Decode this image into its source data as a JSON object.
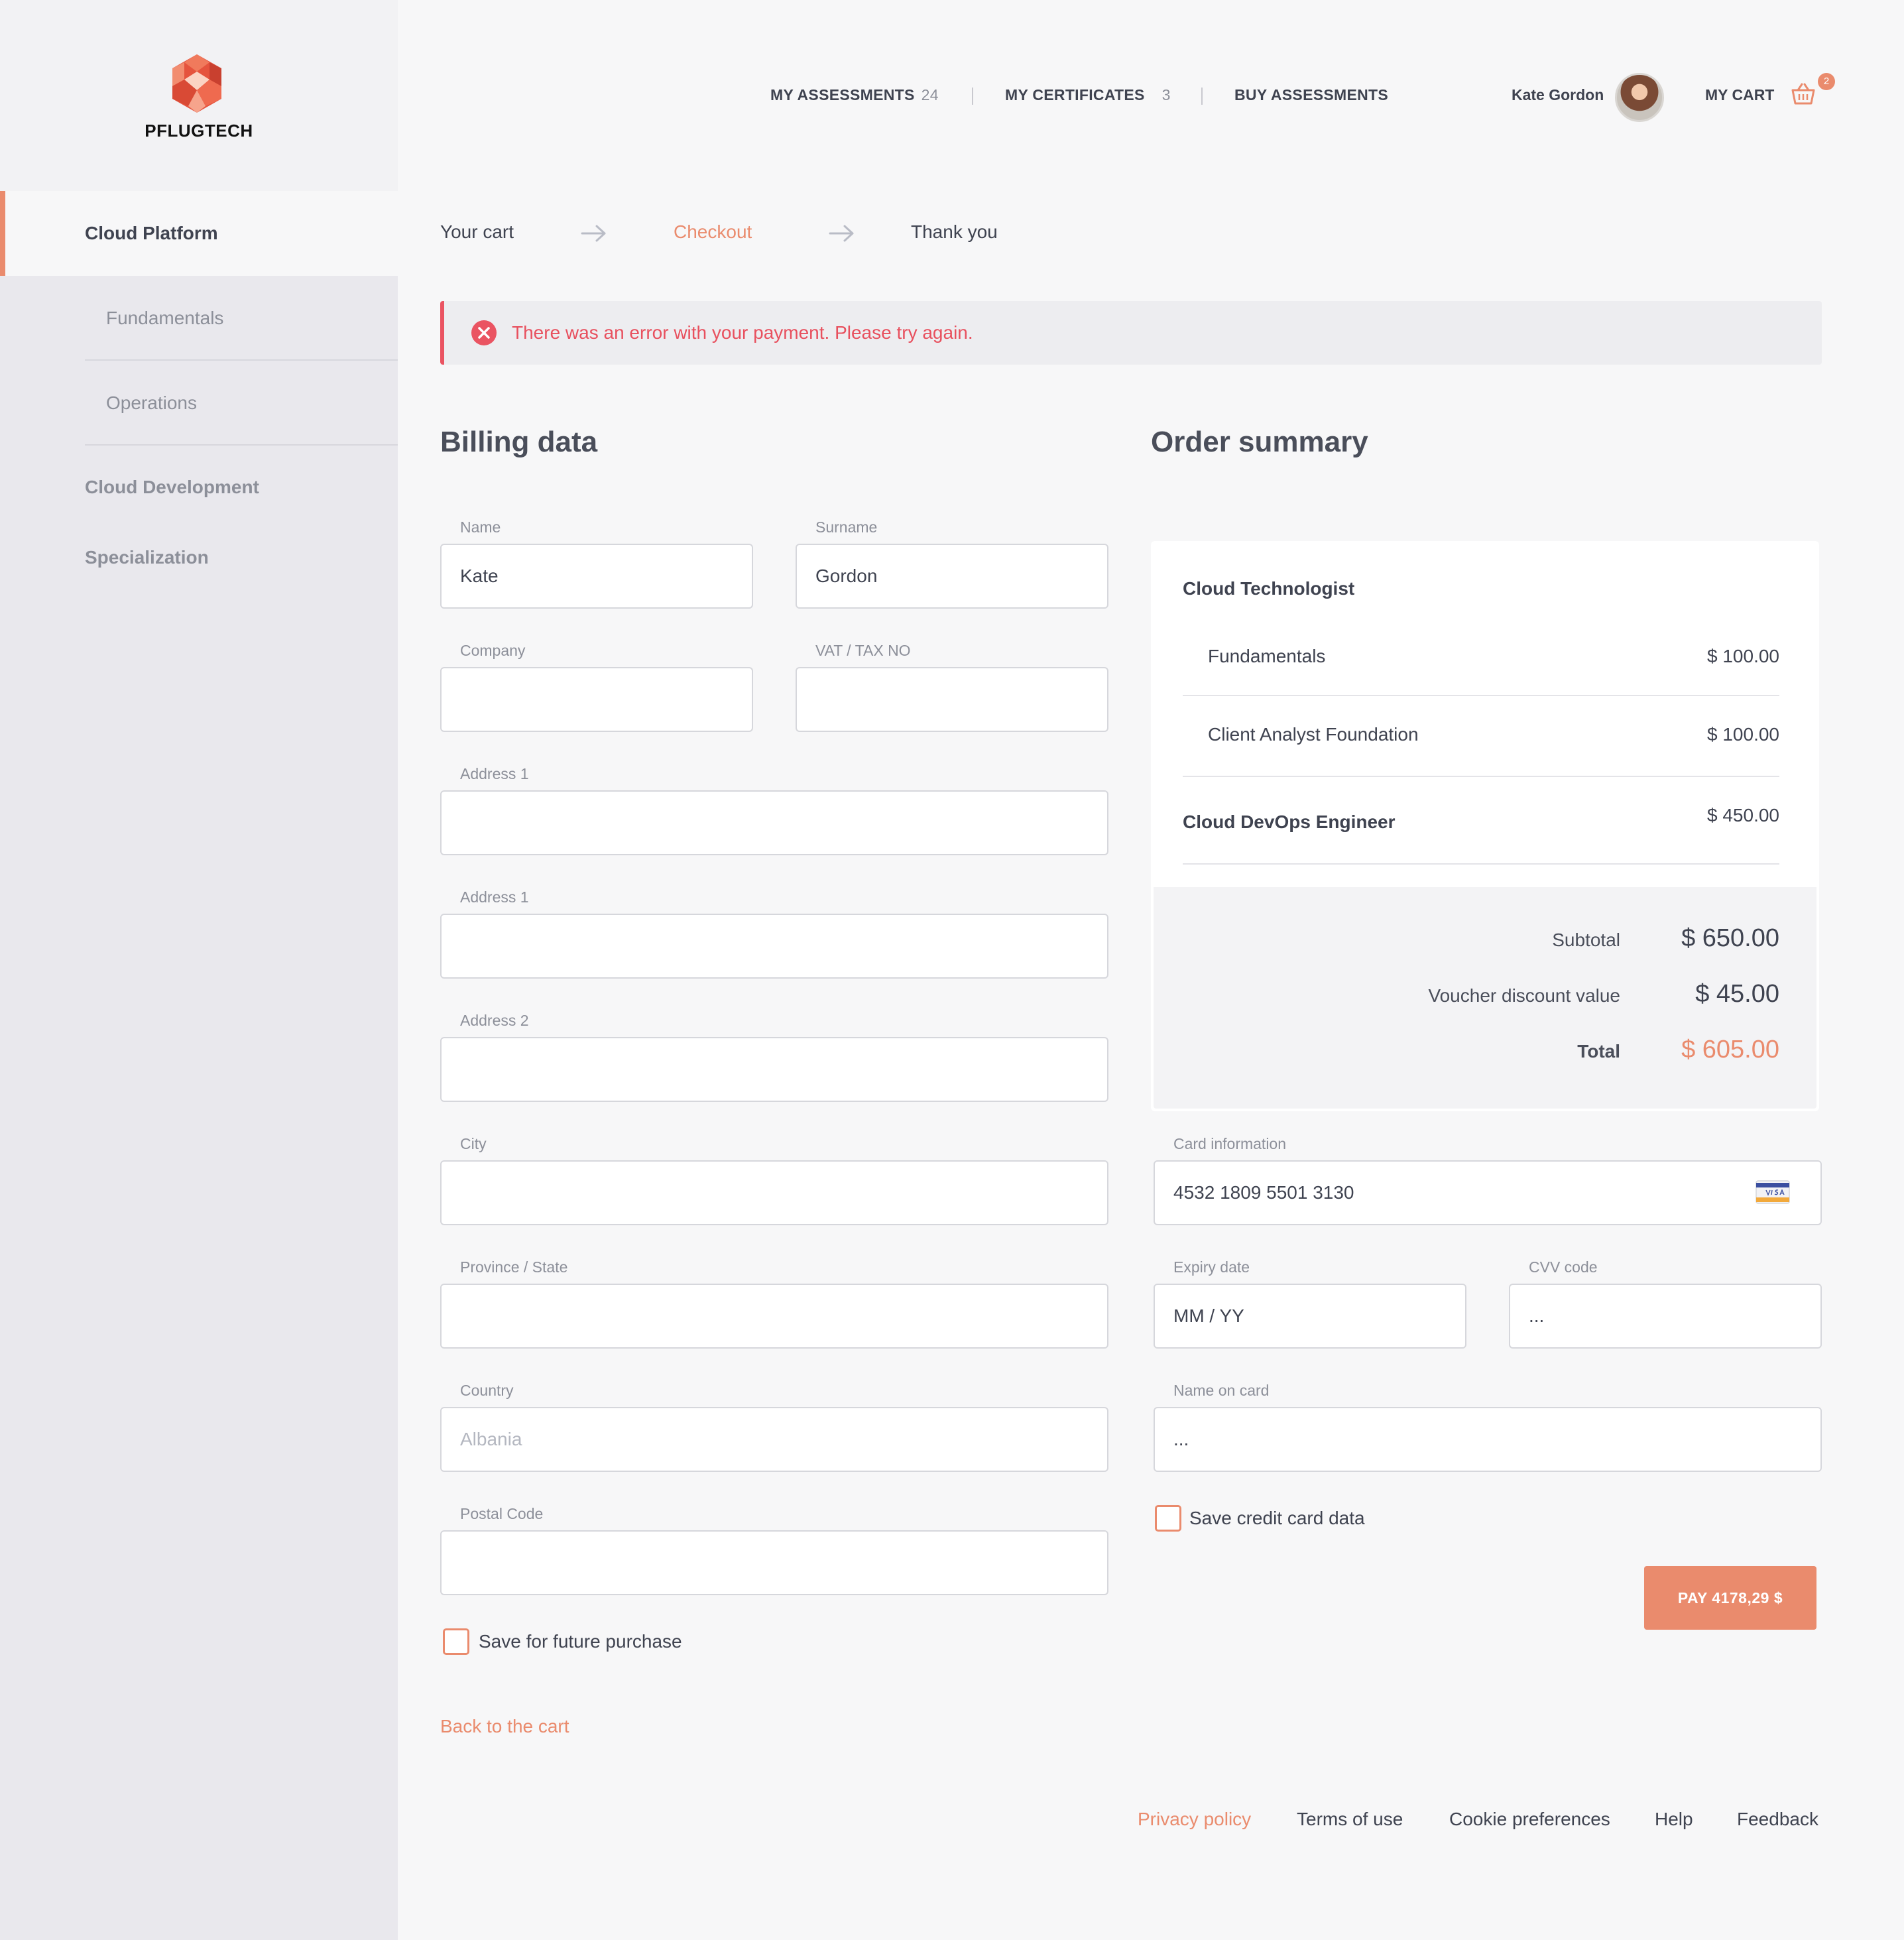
{
  "brand": {
    "name": "PFLUGTECH",
    "accent": "#ea8b6d",
    "error": "#e8505e"
  },
  "sidebar": {
    "items": [
      {
        "label": "Cloud Platform"
      },
      {
        "label": "Fundamentals"
      },
      {
        "label": "Operations"
      },
      {
        "label": "Cloud Development"
      },
      {
        "label": "Specialization"
      }
    ]
  },
  "header": {
    "nav": [
      {
        "label": "MY ASSESSMENTS",
        "count": "24"
      },
      {
        "label": "MY CERTIFICATES",
        "count": "3"
      },
      {
        "label": "BUY ASSESSMENTS"
      }
    ],
    "user_name": "Kate Gordon",
    "cart_label": "MY CART",
    "cart_count": "2"
  },
  "steps": [
    {
      "label": "Your cart"
    },
    {
      "label": "Checkout"
    },
    {
      "label": "Thank you"
    }
  ],
  "error_message": "There was an error with your payment. Please try again.",
  "billing": {
    "title": "Billing data",
    "name": {
      "label": "Name",
      "value": "Kate"
    },
    "surname": {
      "label": "Surname",
      "value": "Gordon"
    },
    "company": {
      "label": "Company",
      "value": ""
    },
    "vat": {
      "label": "VAT / TAX NO",
      "value": ""
    },
    "address1a": {
      "label": "Address 1",
      "value": ""
    },
    "address1b": {
      "label": "Address 1",
      "value": ""
    },
    "address2": {
      "label": "Address 2",
      "value": ""
    },
    "city": {
      "label": "City",
      "value": ""
    },
    "province": {
      "label": "Province / State",
      "value": ""
    },
    "country": {
      "label": "Country",
      "value": "Albania"
    },
    "postal": {
      "label": "Postal Code",
      "value": ""
    },
    "save_label": "Save for future purchase"
  },
  "order": {
    "title": "Order summary",
    "group1": "Cloud Technologist",
    "items": [
      {
        "name": "Fundamentals",
        "price": "$ 100.00"
      },
      {
        "name": "Client Analyst Foundation",
        "price": "$ 100.00"
      }
    ],
    "group2": {
      "name": "Cloud DevOps Engineer",
      "price": "$ 450.00"
    },
    "subtotal_label": "Subtotal",
    "subtotal_value": "$ 650.00",
    "voucher_label": "Voucher discount value",
    "voucher_value": "$ 45.00",
    "total_label": "Total",
    "total_value": "$ 605.00"
  },
  "payment": {
    "card": {
      "label": "Card information",
      "value": "4532 1809 5501 3130"
    },
    "expiry": {
      "label": "Expiry date",
      "value": "MM / YY"
    },
    "cvv": {
      "label": "CVV code",
      "value": "..."
    },
    "name_on_card": {
      "label": "Name on card",
      "value": "..."
    },
    "save_label": "Save credit card data",
    "pay_label": "PAY 4178,29 $"
  },
  "back_link": "Back to the cart",
  "footer": [
    "Privacy policy",
    "Terms of use",
    "Cookie preferences",
    "Help",
    "Feedback"
  ]
}
